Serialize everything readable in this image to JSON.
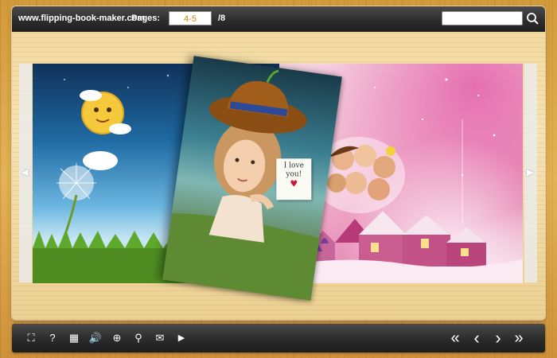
{
  "toolbar_top": {
    "site_title": "www.flipping-book-maker.com",
    "pages_label": "Pages:",
    "page_input_value": "4-5",
    "page_total": "/8",
    "search_value": ""
  },
  "note_text": [
    "I love",
    "you!"
  ],
  "bottom_toolbar": {
    "left_buttons": [
      {
        "name": "fullscreen-icon",
        "glyph": "⛶"
      },
      {
        "name": "help-icon",
        "glyph": "?"
      },
      {
        "name": "thumbnails-icon",
        "glyph": "▦"
      },
      {
        "name": "sound-icon",
        "glyph": "🔊"
      },
      {
        "name": "zoom-in-icon",
        "glyph": "⊕"
      },
      {
        "name": "search-icon",
        "glyph": "⚲"
      },
      {
        "name": "email-icon",
        "glyph": "✉"
      },
      {
        "name": "autoplay-icon",
        "glyph": "▶"
      }
    ],
    "right_buttons": [
      {
        "name": "first-page-icon",
        "glyph": "«"
      },
      {
        "name": "previous-page-icon",
        "glyph": "‹"
      },
      {
        "name": "next-page-icon",
        "glyph": "›"
      },
      {
        "name": "last-page-icon",
        "glyph": "»"
      }
    ]
  },
  "colors": {
    "toolbar_bg": "#2d2d2d",
    "page_number_color": "#c58a00",
    "wood": "#e3b356"
  }
}
